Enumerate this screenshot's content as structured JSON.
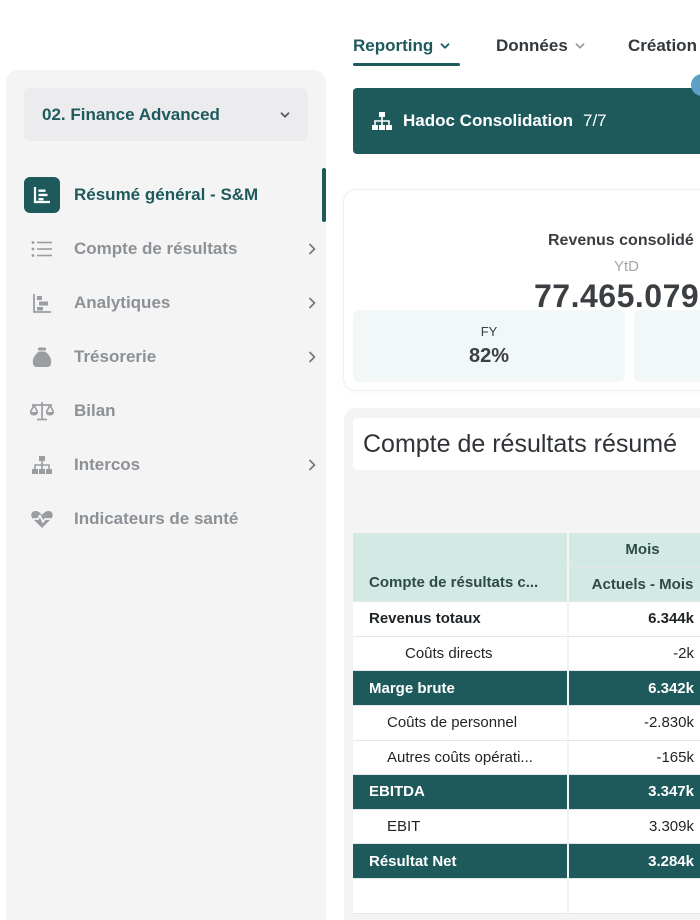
{
  "topnav": {
    "tabs": [
      {
        "label": "Reporting",
        "active": true
      },
      {
        "label": "Données",
        "active": false
      },
      {
        "label": "Création",
        "active": false
      }
    ]
  },
  "sidebar": {
    "org_select": "02. Finance Advanced",
    "items": [
      {
        "label": "Résumé général - S&M",
        "icon": "report-icon",
        "active": true,
        "has_arrow": false
      },
      {
        "label": "Compte de résultats",
        "icon": "list-icon",
        "active": false,
        "has_arrow": true
      },
      {
        "label": "Analytiques",
        "icon": "analytics-icon",
        "active": false,
        "has_arrow": true
      },
      {
        "label": "Trésorerie",
        "icon": "money-bag-icon",
        "active": false,
        "has_arrow": true
      },
      {
        "label": "Bilan",
        "icon": "scale-icon",
        "active": false,
        "has_arrow": false
      },
      {
        "label": "Intercos",
        "icon": "hierarchy-icon",
        "active": false,
        "has_arrow": true
      },
      {
        "label": "Indicateurs de santé",
        "icon": "heartbeat-icon",
        "active": false,
        "has_arrow": false
      }
    ]
  },
  "banner": {
    "title": "Hadoc Consolidation",
    "count": "7/7"
  },
  "kpi": {
    "title": "Revenus consolidé",
    "period": "YtD",
    "value": "77.465.079",
    "sub": [
      {
        "label": "FY",
        "value": "82%"
      }
    ]
  },
  "pl": {
    "title": "Compte de résultats résumé",
    "header_group": "Mois",
    "col1_header": "Compte de résultats c...",
    "col2_header": "Actuels - Mois",
    "rows": [
      {
        "label": "Revenus totaux",
        "value": "6.344k"
      },
      {
        "label": "Coûts directs",
        "value": "-2k"
      },
      {
        "label": "Marge brute",
        "value": "6.342k"
      },
      {
        "label": "Coûts de personnel",
        "value": "-2.830k"
      },
      {
        "label": "Autres coûts opérati...",
        "value": "-165k"
      },
      {
        "label": "EBITDA",
        "value": "3.347k"
      },
      {
        "label": "EBIT",
        "value": "3.309k"
      },
      {
        "label": "Résultat Net",
        "value": "3.284k"
      },
      {
        "label": "",
        "value": ""
      }
    ]
  },
  "colors": {
    "brand": "#1e5a5c",
    "header_mint": "#d3e9e3",
    "kpi_sub_bg": "#f1f8f7",
    "sidebar_bg": "#f4f4f5"
  }
}
